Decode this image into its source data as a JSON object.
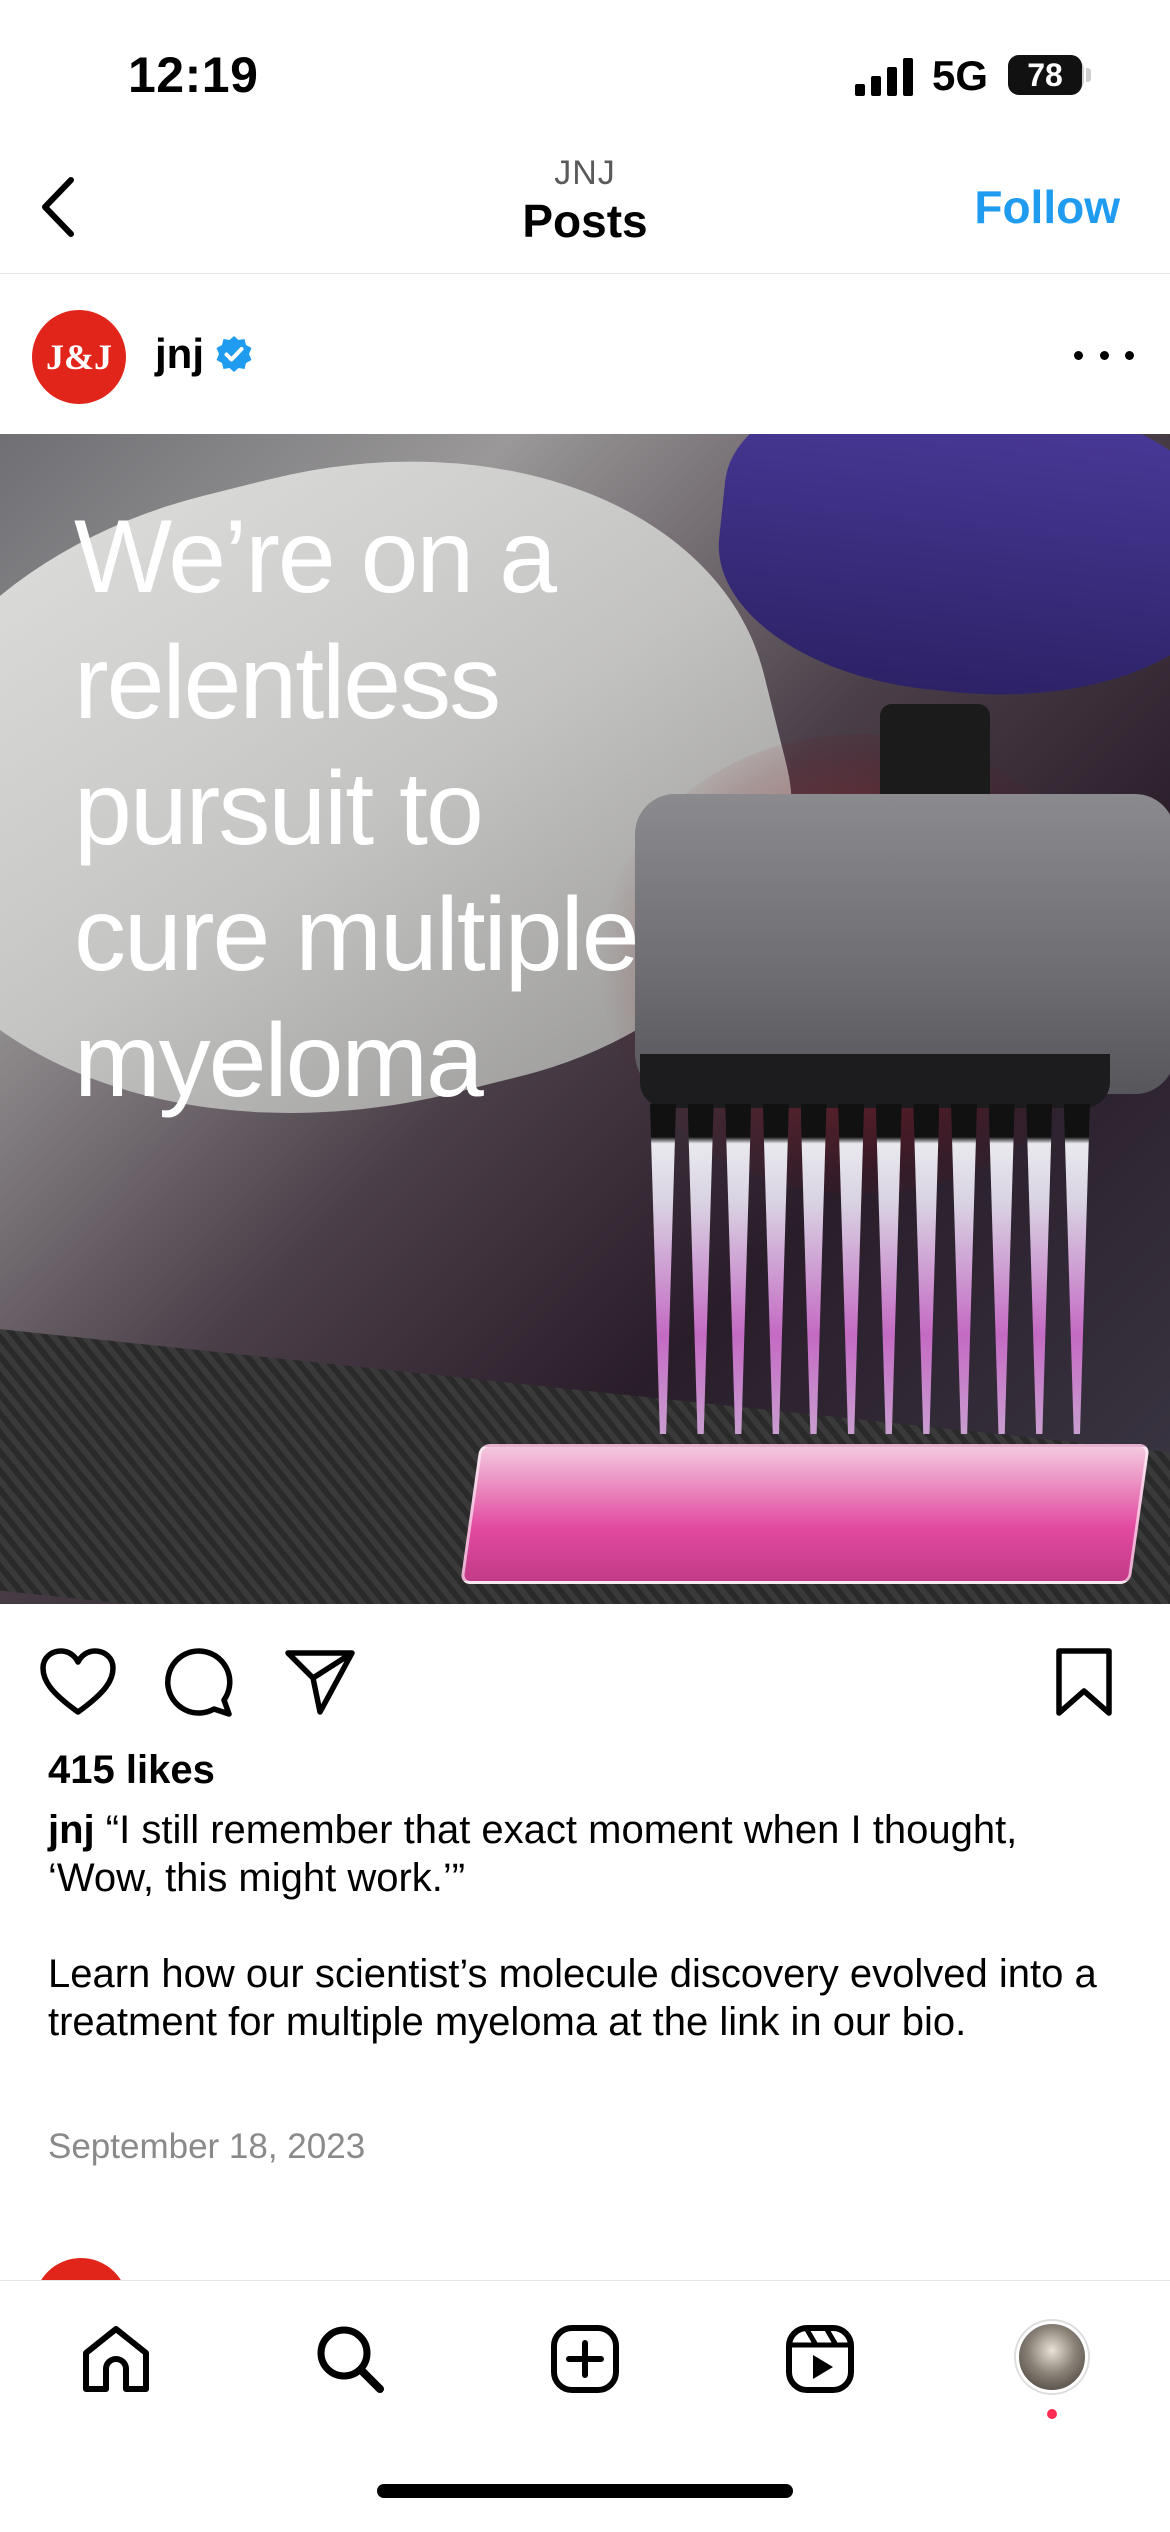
{
  "status_bar": {
    "time": "12:19",
    "network": "5G",
    "battery": "78"
  },
  "header": {
    "subtitle": "JNJ",
    "title": "Posts",
    "follow_label": "Follow"
  },
  "post": {
    "avatar_text": "J&J",
    "username": "jnj",
    "image_text": "We’re on a\nrelentless\npursuit to\ncure multiple\nmyeloma",
    "likes": "415 likes",
    "caption_username": "jnj",
    "caption_quote": " “I still remember that exact moment when I thought, ‘Wow, this might work.’”",
    "caption_body": "Learn how our scientist’s molecule discovery evolved into a treatment for multiple myeloma at the link in our bio.",
    "date": "September 18, 2023"
  },
  "colors": {
    "accent": "#1f9bf0",
    "brand_red": "#e1251b",
    "notification_dot": "#ff2d55"
  },
  "icons": [
    "back-chevron-icon",
    "verified-badge-icon",
    "more-icon",
    "heart-icon",
    "comment-icon",
    "share-icon",
    "bookmark-icon",
    "home-icon",
    "search-icon",
    "create-icon",
    "reels-icon"
  ]
}
